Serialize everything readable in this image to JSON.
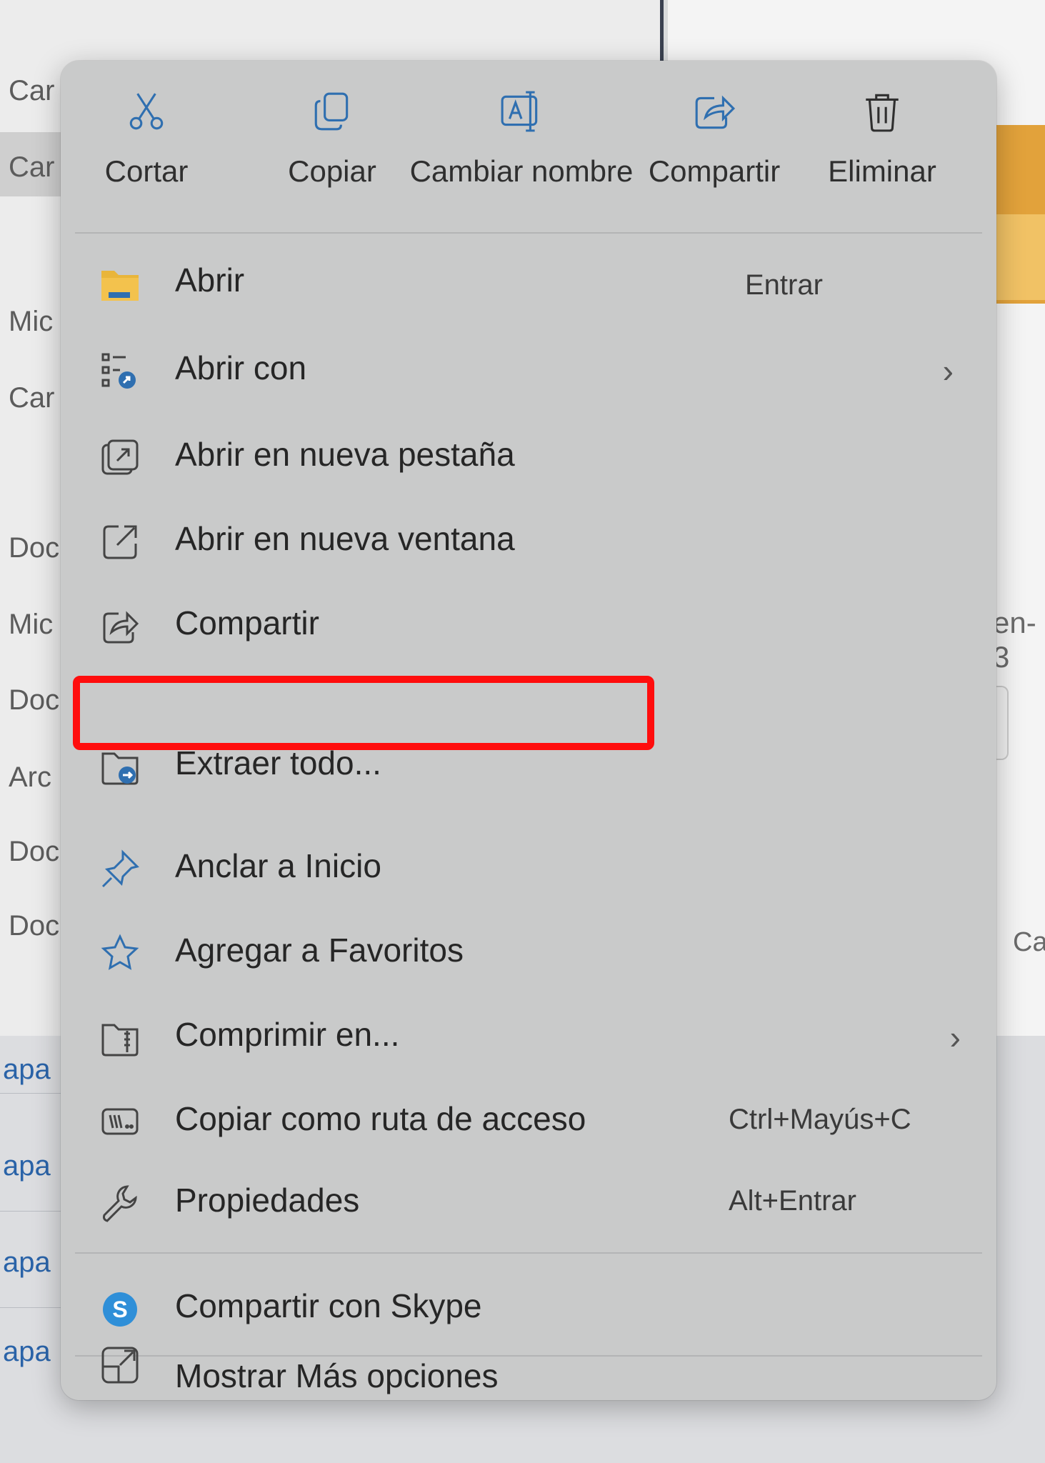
{
  "background": {
    "left_labels": [
      "Car",
      "Car",
      "Mic",
      "Car",
      "Doc",
      "Mic",
      "Doc",
      "Arc",
      "Doc",
      "Doc"
    ],
    "left_links": [
      "apa",
      "apa",
      "apa",
      "apa"
    ],
    "right_fragment_1": "en-3",
    "right_fragment_2": "Ca"
  },
  "toolbar": {
    "cut": "Cortar",
    "copy": "Copiar",
    "rename": "Cambiar nombre",
    "share": "Compartir",
    "delete": "Eliminar"
  },
  "menu": {
    "open": {
      "label": "Abrir",
      "shortcut": "Entrar"
    },
    "open_with": {
      "label": "Abrir con",
      "chevron": "›"
    },
    "open_new_tab": {
      "label": "Abrir en nueva pestaña"
    },
    "open_new_window": {
      "label": "Abrir en nueva ventana"
    },
    "share": {
      "label": "Compartir"
    },
    "extract_all": {
      "label": "Extraer todo..."
    },
    "pin_start": {
      "label": "Anclar a Inicio"
    },
    "add_favorites": {
      "label": "Agregar a Favoritos"
    },
    "compress": {
      "label": "Comprimir en...",
      "chevron": "›"
    },
    "copy_path": {
      "label": "Copiar como ruta de acceso",
      "shortcut": "Ctrl+Mayús+C"
    },
    "properties": {
      "label": "Propiedades",
      "shortcut": "Alt+Entrar"
    },
    "skype": {
      "label": "Compartir con Skype"
    },
    "more_options": {
      "label": "Mostrar Más opciones"
    }
  },
  "colors": {
    "menu_bg": "#c9caca",
    "accent": "#2f6fb0",
    "highlight": "#ff0d0d",
    "folder": "#e9b53a"
  },
  "icons": [
    "cut-icon",
    "copy-icon",
    "rename-icon",
    "share-icon",
    "delete-icon",
    "folder-icon",
    "open-with-icon",
    "new-tab-icon",
    "new-window-icon",
    "share-icon",
    "zip-folder-icon",
    "pin-icon",
    "star-icon",
    "compress-icon",
    "copy-path-icon",
    "wrench-icon",
    "skype-icon",
    "more-options-icon"
  ]
}
